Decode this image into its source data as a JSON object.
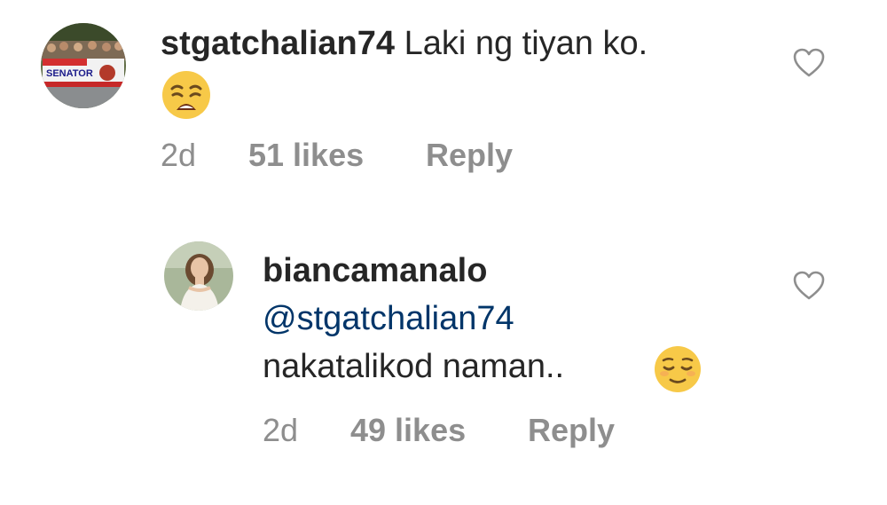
{
  "comments": [
    {
      "username": "stgatchalian74",
      "text": "Laki ng tiyan ko.",
      "emoji": "weary-face",
      "time": "2d",
      "likes": "51 likes",
      "reply_label": "Reply",
      "avatar_sign_text": "WELCOME SENATOR"
    },
    {
      "username": "biancamanalo",
      "mention": "@stgatchalian74",
      "text": "nakatalikod naman..",
      "emoji": "relieved-face",
      "time": "2d",
      "likes": "49 likes",
      "reply_label": "Reply"
    }
  ],
  "colors": {
    "text": "#262626",
    "meta": "#8e8e8e",
    "mention": "#003569",
    "emoji": "#f7c948"
  }
}
